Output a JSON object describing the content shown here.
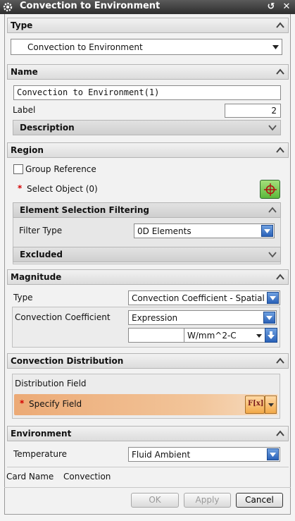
{
  "window": {
    "title": "Convection to Environment"
  },
  "type_section": {
    "header": "Type",
    "selected": "Convection to Environment"
  },
  "name_section": {
    "header": "Name",
    "name_value": "Convection to Environment(1)",
    "label_caption": "Label",
    "label_value": "2",
    "description_header": "Description"
  },
  "region_section": {
    "header": "Region",
    "group_reference": "Group Reference",
    "select_object": "Select Object (0)",
    "filtering_header": "Element Selection Filtering",
    "filter_type_label": "Filter Type",
    "filter_type_value": "0D Elements",
    "excluded_header": "Excluded"
  },
  "magnitude_section": {
    "header": "Magnitude",
    "type_label": "Type",
    "type_value": "Convection Coefficient - Spatial",
    "coef_label": "Convection Coefficient",
    "coef_value": "Expression",
    "expr_value": "",
    "unit": "W/mm^2-C"
  },
  "distribution_section": {
    "header": "Convection Distribution",
    "field_label": "Distribution Field",
    "specify_field": "Specify Field",
    "fx_label": "F[x]"
  },
  "environment_section": {
    "header": "Environment",
    "temperature_label": "Temperature",
    "temperature_value": "Fluid Ambient"
  },
  "card": {
    "label": "Card Name",
    "value": "Convection"
  },
  "buttons": {
    "ok": "OK",
    "apply": "Apply",
    "cancel": "Cancel"
  },
  "colors": {
    "specify_field_bg": "#e8a26a",
    "accent_blue": "#2a62b8",
    "required": "#d40000"
  }
}
